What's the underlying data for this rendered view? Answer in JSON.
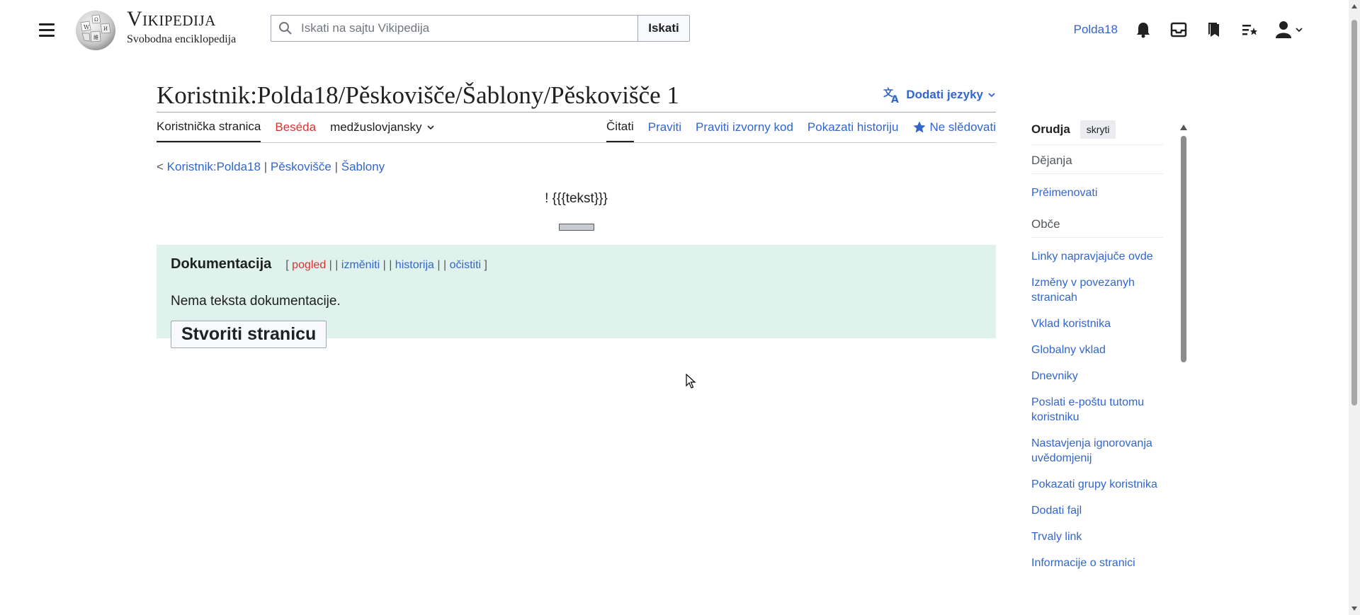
{
  "header": {
    "site_name": "Vikipedija",
    "tagline": "Svobodna enciklopedija",
    "search_placeholder": "Iskati na sajtu Vikipedija",
    "search_button": "Iskati",
    "username": "Polda18"
  },
  "page": {
    "title": "Koristnik:Polda18/Pěskovišče/Šablony/Pěskovišče 1",
    "lang_button": "Dodati jezyky"
  },
  "tabs_left": {
    "user_page": "Koristnička stranica",
    "talk": "Beséda",
    "language": "medžuslovjansky"
  },
  "tabs_right": {
    "read": "Čitati",
    "edit": "Praviti",
    "edit_source": "Praviti izvorny kod",
    "history": "Pokazati historiju",
    "unwatch": "Ne slědovati"
  },
  "breadcrumb": {
    "prefix": "<",
    "link1": "Koristnik:Polda18",
    "sep1": "|",
    "link2": "Pěskovišče",
    "sep2": "|",
    "link3": "Šablony"
  },
  "content": {
    "template_text": "! {{{tekst}}}"
  },
  "documentation": {
    "title": "Dokumentacija",
    "open_bracket": "[",
    "view": "pogled",
    "sep": "|",
    "edit": "izměniti",
    "history": "historija",
    "purge": "očistiti",
    "close_bracket": "]",
    "no_doc_text": "Nema teksta dokumentacije.",
    "create_button": "Stvoriti stranicu"
  },
  "tools": {
    "title": "Orudja",
    "hide_button": "skryti",
    "section_actions": "Dějanja",
    "rename": "Prěimenovati",
    "section_general": "Obče",
    "items": [
      "Linky napravjajuče ovde",
      "Izměny v povezanyh stranicah",
      "Vklad koristnika",
      "Globalny vklad",
      "Dnevniky",
      "Poslati e-poštu tutomu koristniku",
      "Nastavjenja ignorovanja uvědomjenij",
      "Pokazati grupy koristnika",
      "Dodati fajl",
      "Trvaly link",
      "Informacije o stranici"
    ]
  }
}
